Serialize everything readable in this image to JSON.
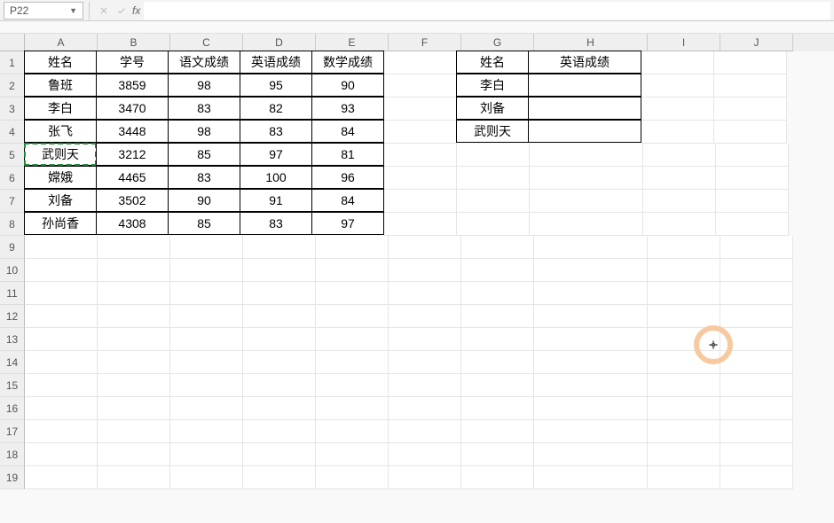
{
  "nameBox": "P22",
  "fx": "fx",
  "columns": [
    "A",
    "B",
    "C",
    "D",
    "E",
    "F",
    "G",
    "H",
    "I",
    "J"
  ],
  "rowCount": 19,
  "table1": {
    "header": [
      "姓名",
      "学号",
      "语文成绩",
      "英语成绩",
      "数学成绩"
    ],
    "rows": [
      [
        "鲁班",
        "3859",
        "98",
        "95",
        "90"
      ],
      [
        "李白",
        "3470",
        "83",
        "82",
        "93"
      ],
      [
        "张飞",
        "3448",
        "98",
        "83",
        "84"
      ],
      [
        "武则天",
        "3212",
        "85",
        "97",
        "81"
      ],
      [
        "嫦娥",
        "4465",
        "83",
        "100",
        "96"
      ],
      [
        "刘备",
        "3502",
        "90",
        "91",
        "84"
      ],
      [
        "孙尚香",
        "4308",
        "85",
        "83",
        "97"
      ]
    ]
  },
  "table2": {
    "header": [
      "姓名",
      "英语成绩"
    ],
    "rows": [
      [
        "李白",
        ""
      ],
      [
        "刘备",
        ""
      ],
      [
        "武则天",
        ""
      ]
    ]
  },
  "marchingCell": "A5"
}
